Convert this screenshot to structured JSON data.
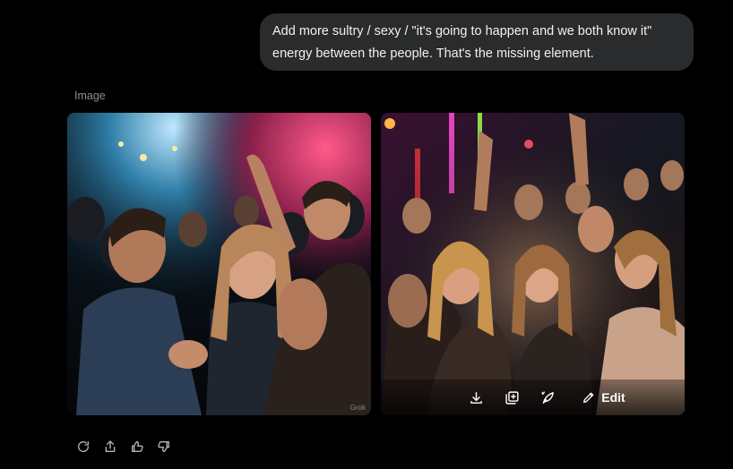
{
  "message": {
    "line1": "Add more sultry / sexy / \"it's going to happen and we both know it\"",
    "line2": "energy between the people. That's the missing element."
  },
  "response": {
    "label": "Image",
    "images": [
      {
        "subject": "crowded nightclub, man and laughing woman dancing close under colored stage lights",
        "watermark": "Grok"
      },
      {
        "subject": "excited party crowd cheering under neon lights with two women singing at front"
      }
    ],
    "image_toolbar": {
      "icons": [
        "download-icon",
        "add-image-icon",
        "animate-icon",
        "pencil-icon"
      ],
      "edit_label": "Edit"
    },
    "actions": [
      "regenerate-icon",
      "share-icon",
      "thumbs-up-icon",
      "thumbs-down-icon"
    ]
  },
  "colors": {
    "background": "#000000",
    "bubble": "#2a2b2d",
    "muted_text": "#8e8e8e"
  }
}
